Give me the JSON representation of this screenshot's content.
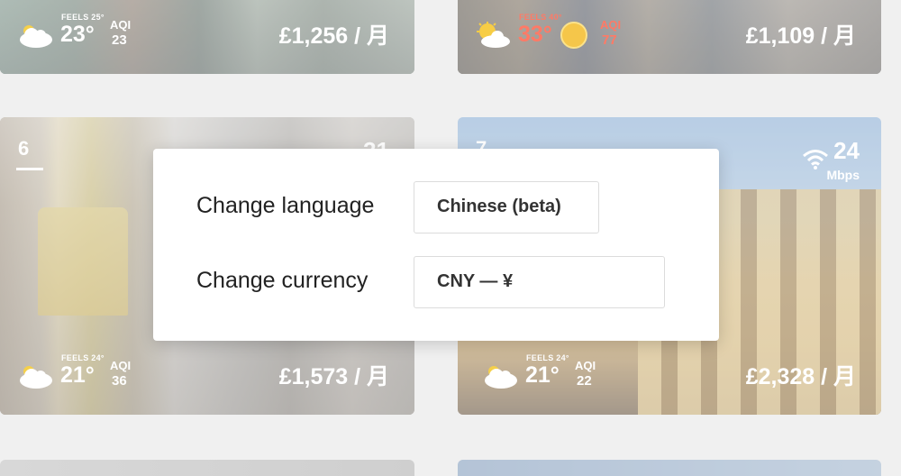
{
  "cards": [
    {
      "feels": "FEELS 25°",
      "temp": "23°",
      "aqi_label": "AQI",
      "aqi_value": "23",
      "price": "£1,256 / 月",
      "weather_icon": "cloud-icon"
    },
    {
      "feels": "FEELS 40°",
      "temp": "33°",
      "aqi_label": "AQI",
      "aqi_value": "77",
      "price": "£1,109 / 月",
      "weather_icon": "sun-cloud-icon",
      "aqi_icon": "face-mask-icon"
    },
    {
      "rank": "6",
      "top_right": "31",
      "feels": "FEELS 24°",
      "temp": "21°",
      "aqi_label": "AQI",
      "aqi_value": "36",
      "price": "£1,573 / 月",
      "weather_icon": "cloud-icon"
    },
    {
      "rank": "7",
      "wifi_value": "24",
      "wifi_unit": "Mbps",
      "feels": "FEELS 24°",
      "temp": "21°",
      "aqi_label": "AQI",
      "aqi_value": "22",
      "price": "£2,328 / 月",
      "weather_icon": "cloud-icon",
      "wifi_icon": "wifi-icon"
    }
  ],
  "modal": {
    "language_label": "Change language",
    "language_value": "Chinese (beta)",
    "currency_label": "Change currency",
    "currency_value": "CNY — ¥"
  },
  "colors": {
    "hot_text": "#ff7a66",
    "modal_bg": "#ffffff",
    "page_bg": "#f0f0f0"
  }
}
